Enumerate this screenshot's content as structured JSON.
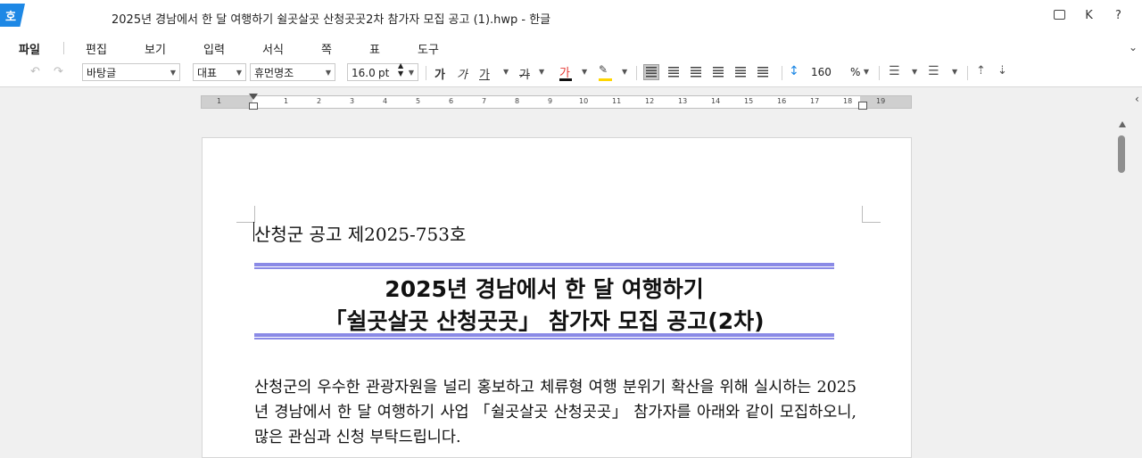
{
  "titlebar": {
    "app_glyph": "호",
    "document_title": "2025년 경남에서 한 달 여행하기 쉴곳살곳 산청곳곳2차 참가자 모집 공고 (1).hwp - 한글",
    "user_initial": "K",
    "help": "?"
  },
  "menu": {
    "items": [
      "파일",
      "편집",
      "보기",
      "입력",
      "서식",
      "쪽",
      "표",
      "도구"
    ],
    "collapse": "⌄"
  },
  "toolbar": {
    "undo": "↶",
    "redo": "↷",
    "style": "바탕글",
    "font_lang": "대표",
    "font_name": "휴먼명조",
    "font_size": "16.0",
    "font_unit": "pt",
    "bold": "가",
    "italic": "가",
    "underline": "가",
    "strike": "가",
    "font_color": "가",
    "line_spacing": "160",
    "line_spacing_unit": "%",
    "colors": {
      "font_color_bar": "#e53935",
      "highlight_bar": "#ffd600"
    }
  },
  "ruler": {
    "numbers": [
      "1",
      "1",
      "2",
      "3",
      "4",
      "5",
      "6",
      "7",
      "8",
      "9",
      "10",
      "11",
      "12",
      "13",
      "14",
      "15",
      "16",
      "17",
      "18",
      "19"
    ]
  },
  "document": {
    "notice_number": "산청군 공고 제2025-753호",
    "headline_line1": "2025년 경남에서 한 달 여행하기",
    "headline_line2": "「쉴곳살곳 산청곳곳」 참가자 모집 공고(2차)",
    "body": " 산청군의 우수한 관광자원을 널리 홍보하고 체류형 여행 분위기 확산을 위해 실시하는 2025년 경남에서 한 달 여행하기 사업 「쉴곳살곳 산청곳곳」 참가자를 아래와 같이 모집하오니, 많은 관심과 신청 부탁드립니다.",
    "accent_color": "#8a8ae6"
  },
  "sidebar_toggle": "‹"
}
